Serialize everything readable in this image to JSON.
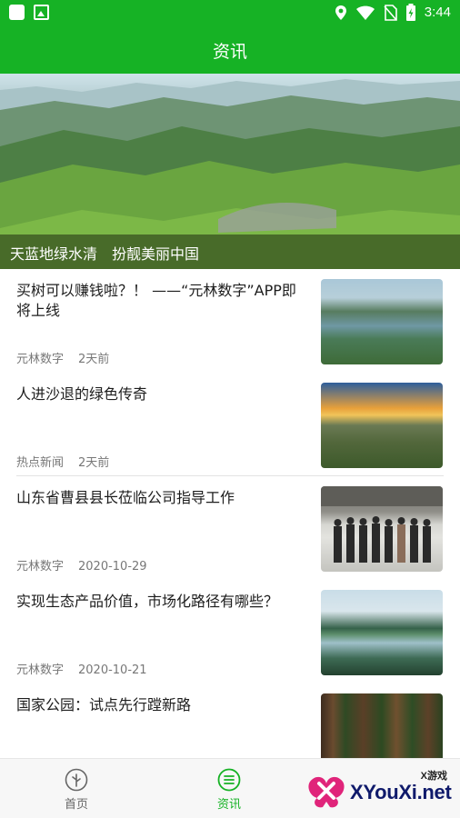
{
  "status_bar": {
    "time": "3:44",
    "icons": [
      "app-square-icon",
      "image-icon",
      "location-icon",
      "wifi-icon",
      "no-sim-icon",
      "battery-charging-icon"
    ]
  },
  "header": {
    "title": "资讯"
  },
  "banner": {
    "caption": "天蓝地绿水清　扮靓美丽中国"
  },
  "news": [
    {
      "title": "买树可以赚钱啦？！ ——“元林数字”APP即将上线",
      "source": "元林数字",
      "time": "2天前"
    },
    {
      "title": "人进沙退的绿色传奇",
      "source": "热点新闻",
      "time": "2天前"
    },
    {
      "title": "山东省曹县县长莅临公司指导工作",
      "source": "元林数字",
      "time": "2020-10-29"
    },
    {
      "title": "实现生态产品价值，市场化路径有哪些？",
      "source": "元林数字",
      "time": "2020-10-21"
    },
    {
      "title": "国家公园：试点先行蹚新路",
      "source": "",
      "time": ""
    }
  ],
  "bottom_nav": {
    "tabs": [
      {
        "label": "首页",
        "icon": "tree-icon",
        "active": false
      },
      {
        "label": "资讯",
        "icon": "news-menu-icon",
        "active": true
      }
    ]
  },
  "watermark": {
    "small": "X游戏",
    "text": "XYouXi.net"
  },
  "colors": {
    "brand_green": "#16b225",
    "meta_gray": "#777777",
    "watermark_blue": "#0f1a6b",
    "watermark_pink": "#e0247a"
  }
}
